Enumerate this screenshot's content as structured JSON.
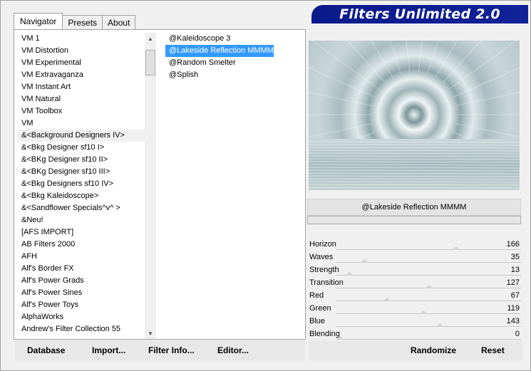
{
  "app": {
    "title": "Filters Unlimited 2.0"
  },
  "tabs": [
    {
      "label": "Navigator",
      "active": true
    },
    {
      "label": "Presets",
      "active": false
    },
    {
      "label": "About",
      "active": false
    }
  ],
  "categories": [
    "VM 1",
    "VM Distortion",
    "VM Experimental",
    "VM Extravaganza",
    "VM Instant Art",
    "VM Natural",
    "VM Toolbox",
    "VM",
    "&<Background Designers IV>",
    "&<Bkg Designer sf10 I>",
    "&<BKg Designer sf10 II>",
    "&<BKg Designer sf10 III>",
    "&<Bkg Designers sf10 IV>",
    "&<Bkg Kaleidoscope>",
    "&<Sandflower Specials^v^ >",
    "&Neu!",
    "[AFS IMPORT]",
    "AB Filters 2000",
    "AFH",
    "Alf's Border FX",
    "Alf's Power Grads",
    "Alf's Power Sines",
    "Alf's Power Toys",
    "AlphaWorks",
    "Andrew's Filter Collection 55"
  ],
  "selected_category": "&<Background Designers IV>",
  "filters": [
    "@Kaleidoscope 3",
    "@Lakeside Reflection MMMM",
    "@Random Smelter",
    "@Splish"
  ],
  "selected_filter": "@Lakeside Reflection MMMM",
  "preview": {
    "filter_name": "@Lakeside Reflection MMMM"
  },
  "parameters": [
    {
      "label": "Horizon",
      "value": 166
    },
    {
      "label": "Waves",
      "value": 35
    },
    {
      "label": "Strength",
      "value": 13
    },
    {
      "label": "Transition",
      "value": 127
    },
    {
      "label": "Red",
      "value": 67
    },
    {
      "label": "Green",
      "value": 119
    },
    {
      "label": "Blue",
      "value": 143
    },
    {
      "label": "Blending",
      "value": 0
    }
  ],
  "buttons": {
    "database": "Database",
    "import": "Import...",
    "filter_info": "Filter Info...",
    "editor": "Editor...",
    "randomize": "Randomize",
    "reset": "Reset"
  },
  "colors": {
    "banner": "#112299",
    "selection": "#3399ff"
  },
  "icons": {
    "scroll_up": "up-arrow-icon",
    "scroll_down": "down-arrow-icon"
  }
}
